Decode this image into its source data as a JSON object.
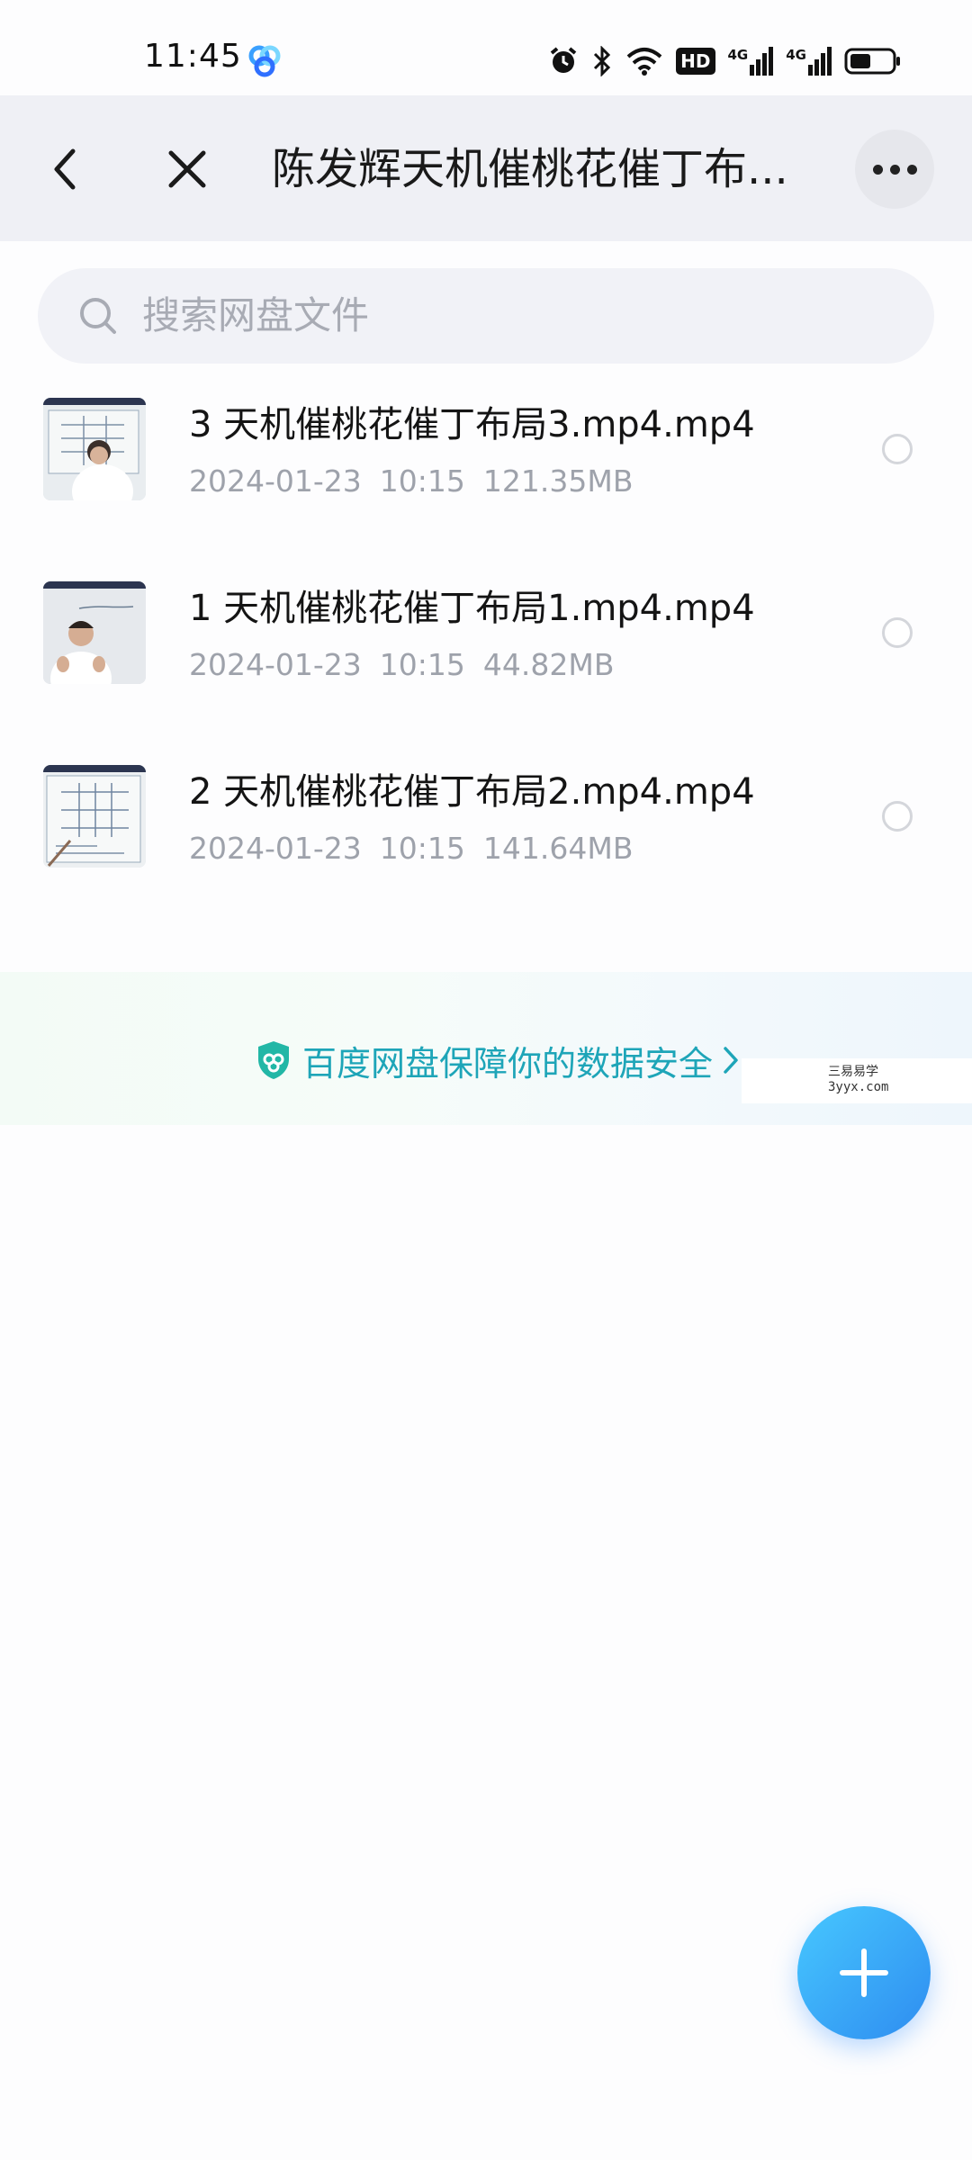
{
  "status_bar": {
    "time": "11:45",
    "network_1": "4G",
    "network_2": "4G",
    "hd_badge": "HD"
  },
  "header": {
    "title": "陈发辉天机催桃花催丁布...",
    "back_icon": "chevron-left-icon",
    "close_icon": "close-icon",
    "more_icon": "more-horizontal-icon"
  },
  "search": {
    "placeholder": "搜索网盘文件",
    "value": ""
  },
  "files": [
    {
      "name": "3 天机催桃花催丁布局3.mp4.mp4",
      "date": "2024-01-23",
      "time": "10:15",
      "size": "121.35MB"
    },
    {
      "name": "1 天机催桃花催丁布局1.mp4.mp4",
      "date": "2024-01-23",
      "time": "10:15",
      "size": "44.82MB"
    },
    {
      "name": "2 天机催桃花催丁布局2.mp4.mp4",
      "date": "2024-01-23",
      "time": "10:15",
      "size": "141.64MB"
    }
  ],
  "security_banner": {
    "text": "百度网盘保障你的数据安全",
    "icon": "shield-icon"
  },
  "watermark": {
    "line1": "三易易学",
    "line2": "3yyx.com"
  },
  "fab": {
    "icon": "plus-icon"
  },
  "colors": {
    "accent": "#2e8cf0",
    "security_text": "#1ea5b8",
    "header_bg": "#eff0f5"
  }
}
